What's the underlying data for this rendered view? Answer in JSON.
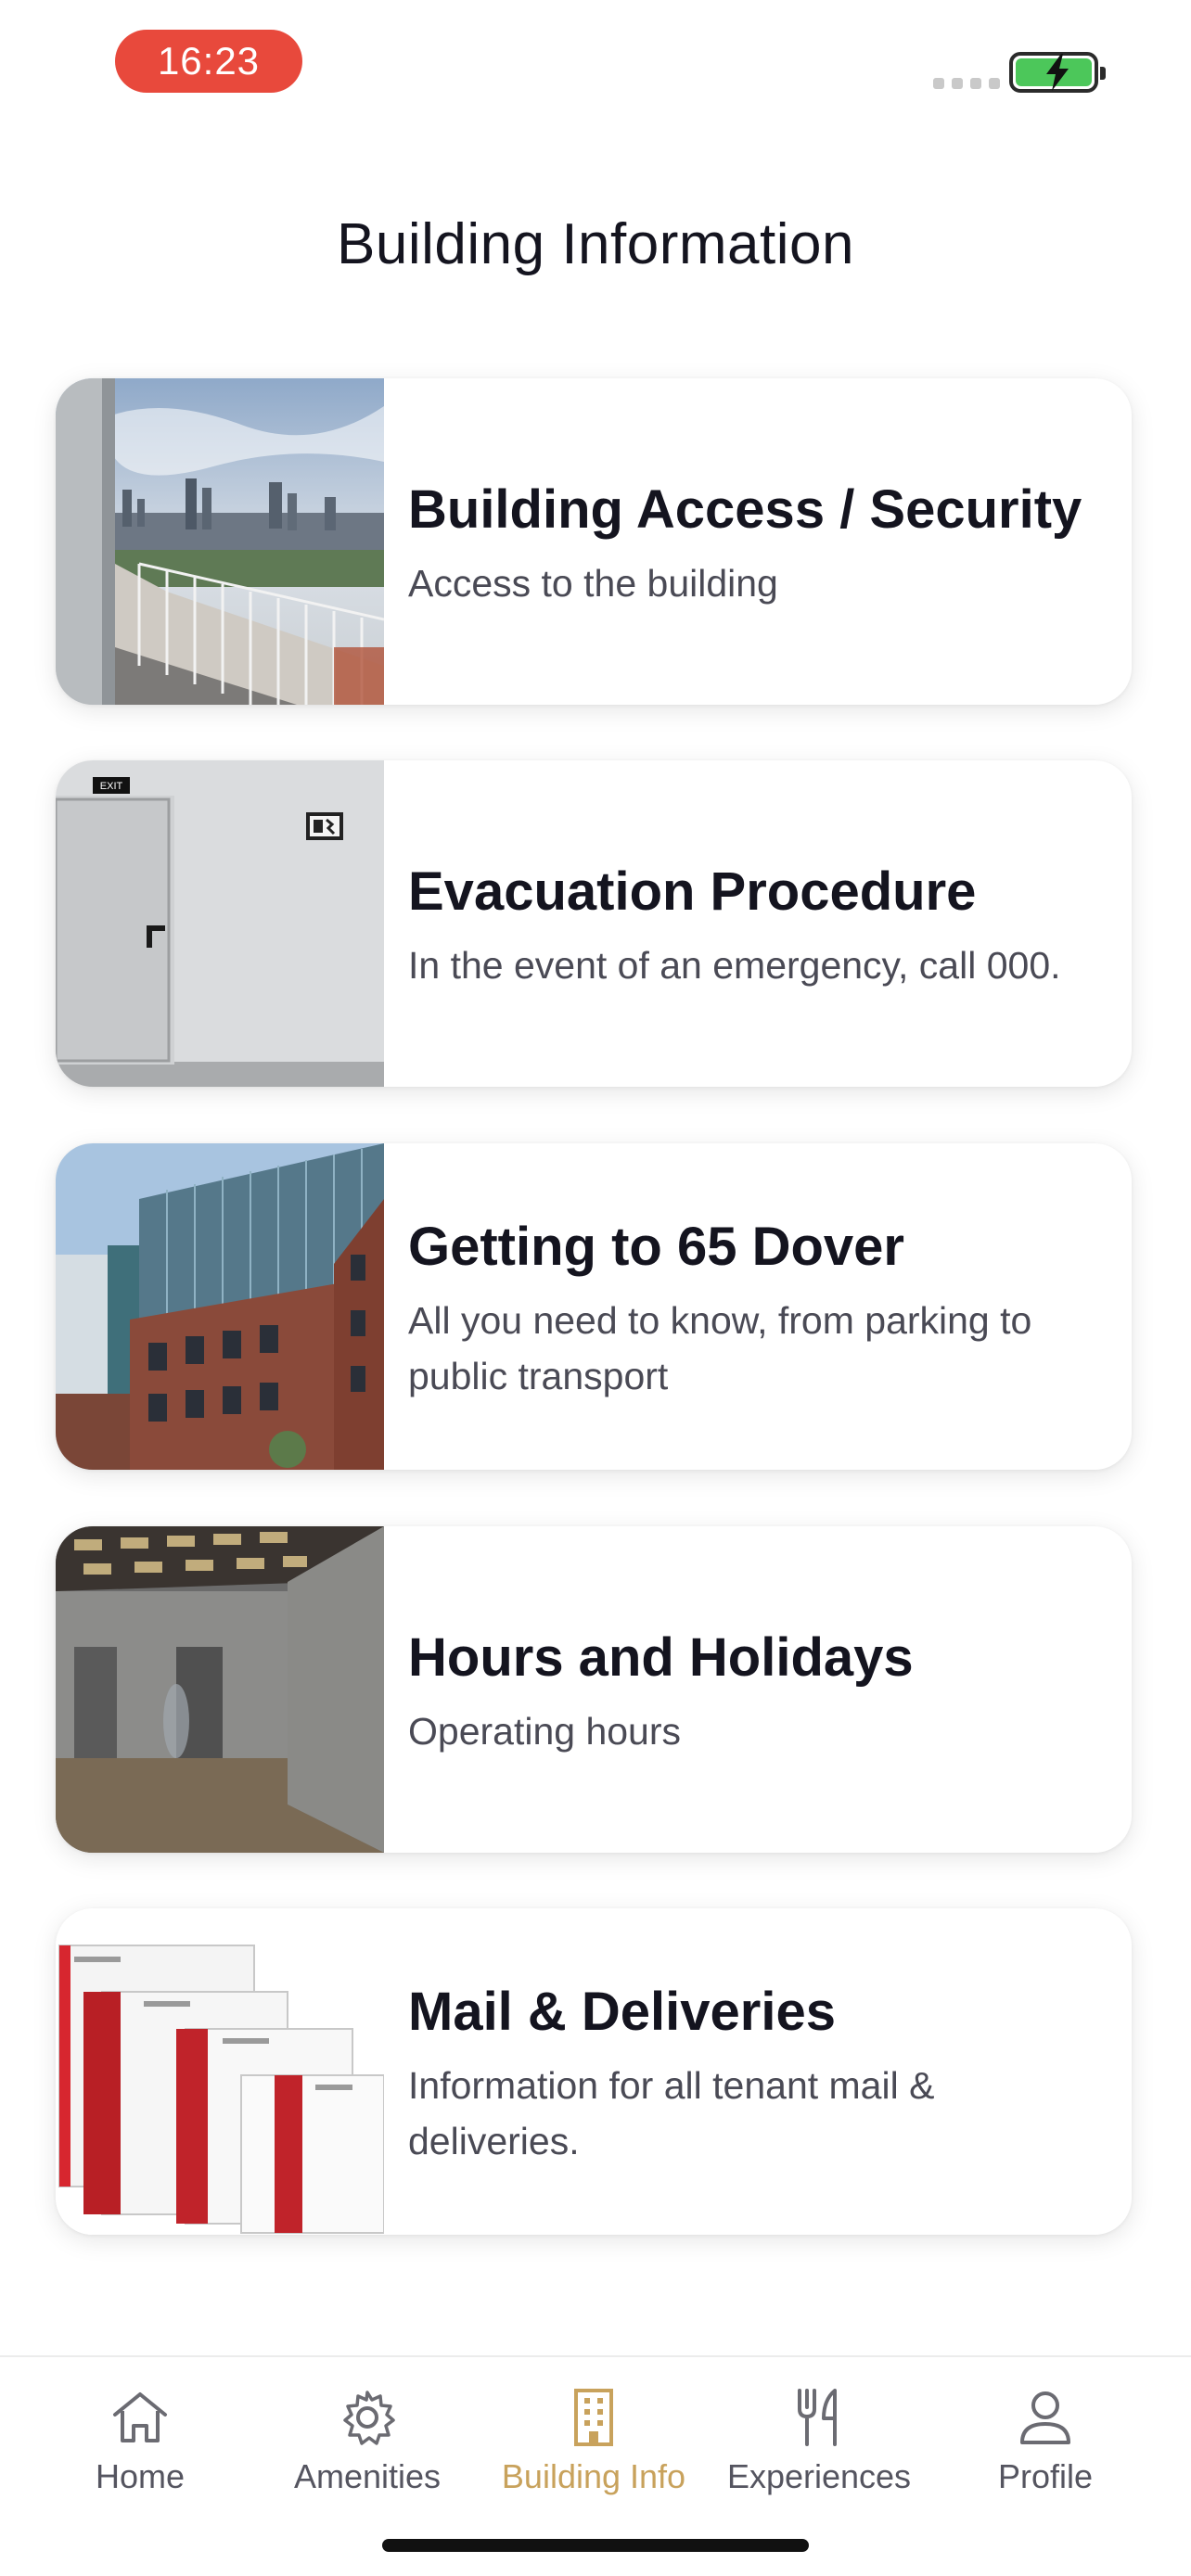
{
  "status_bar": {
    "time": "16:23"
  },
  "header": {
    "title": "Building Information"
  },
  "cards": [
    {
      "title": "Building Access / Security",
      "subtitle": "Access to the building",
      "image": "city-balcony-photo"
    },
    {
      "title": "Evacuation Procedure",
      "subtitle": "In the event of an emergency, call 000.",
      "image": "exit-door-photo"
    },
    {
      "title": "Getting to 65 Dover",
      "subtitle": "All you need to know, from parking to public transport",
      "image": "building-exterior-photo"
    },
    {
      "title": "Hours and Holidays",
      "subtitle": "Operating hours",
      "image": "lobby-elevator-photo"
    },
    {
      "title": "Mail & Deliveries",
      "subtitle": "Information for all tenant mail & deliveries.",
      "image": "parcel-boxes-photo"
    }
  ],
  "nav": {
    "items": [
      {
        "label": "Home",
        "icon": "home-icon"
      },
      {
        "label": "Amenities",
        "icon": "gear-icon"
      },
      {
        "label": "Building Info",
        "icon": "building-icon",
        "active": true
      },
      {
        "label": "Experiences",
        "icon": "cutlery-icon"
      },
      {
        "label": "Profile",
        "icon": "profile-icon"
      }
    ]
  },
  "colors": {
    "accent": "#c8a25c",
    "time_pill": "#e8493c",
    "battery": "#4cc75a"
  }
}
